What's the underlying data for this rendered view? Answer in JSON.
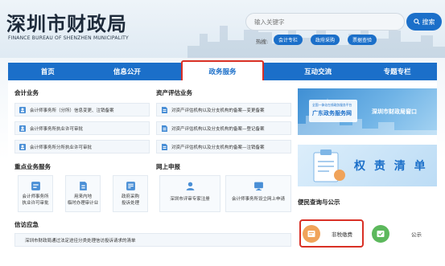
{
  "header": {
    "title_cn": "深圳市财政局",
    "title_en": "FINANCE BUREAU OF SHENZHEN MUNICIPALITY",
    "search_placeholder": "输入关键字",
    "search_button": "搜索",
    "hot_label": "热搜:",
    "hot_tags": [
      "会计专栏",
      "政府采购",
      "票据查验"
    ]
  },
  "nav": {
    "items": [
      "首页",
      "信息公开",
      "政务服务",
      "互动交流",
      "专题专栏"
    ],
    "active_index": 2
  },
  "accounting": {
    "title": "会计业务",
    "items": [
      "会计师事务所（分所）信息变更、注销备案",
      "会计师事务所执业许可审批",
      "会计师事务所分所执业许可审批"
    ]
  },
  "asset_eval": {
    "title": "资产评估业务",
    "items": [
      "对资产评估机构以及分支机构的备案—变更备案",
      "对资产评估机构以及分支机构的备案—登记备案",
      "对资产评估机构以及分支机构的备案—注销备案"
    ]
  },
  "key_business": {
    "title": "重点业务服务",
    "tiles": [
      [
        "会计师事务所",
        "执业许可审批"
      ],
      [
        "用来内地",
        "临时办理审计业"
      ],
      [
        "政府采购",
        "投诉处理"
      ]
    ]
  },
  "online_apply": {
    "title": "网上申报",
    "tiles": [
      "深圳市评审专家注册",
      "会计师事务所设立网上申请"
    ]
  },
  "petition": {
    "title": "信访应急",
    "item": "深圳市财政局通过法定途径分类处理信访投诉请求的清单"
  },
  "banner1": {
    "sub": "全国一体化在线政务服务平台",
    "main": "广东政务服务网",
    "right": "深圳市财政局窗口"
  },
  "banner2": {
    "text": "权 责 清 单"
  },
  "convenience": {
    "title": "便民查询与公示",
    "items": [
      "非税缴费",
      "公示"
    ]
  },
  "colors": {
    "brand_blue": "#1b6fc9",
    "highlight_red": "#d93025",
    "fee_orange": "#f0a35a",
    "notice_green": "#5cb85c"
  }
}
